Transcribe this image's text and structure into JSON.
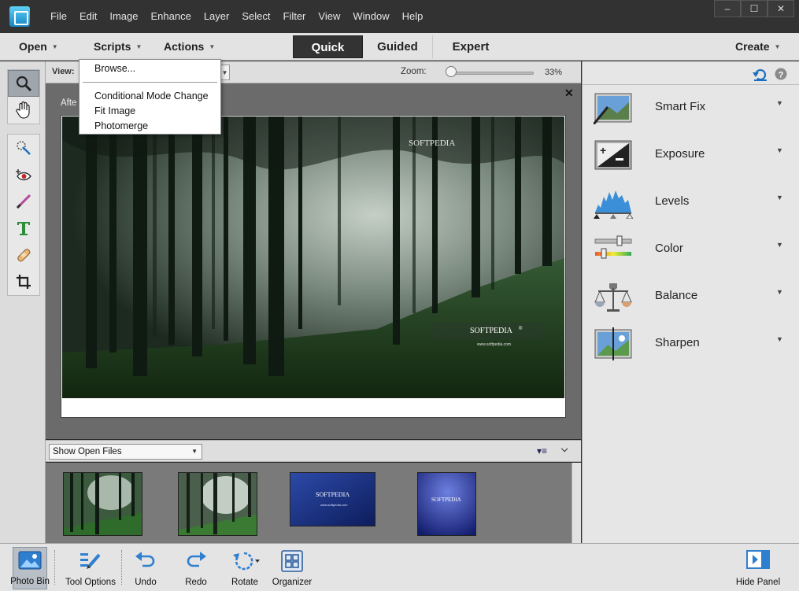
{
  "menubar": {
    "items": [
      "File",
      "Edit",
      "Image",
      "Enhance",
      "Layer",
      "Select",
      "Filter",
      "View",
      "Window",
      "Help"
    ],
    "window_buttons": [
      "–",
      "☐",
      "✕"
    ]
  },
  "modebar": {
    "open_label": "Open",
    "scripts_label": "Scripts",
    "actions_label": "Actions",
    "tabs": [
      "Quick",
      "Guided",
      "Expert"
    ],
    "active_tab": "Quick",
    "create_label": "Create"
  },
  "scripts_menu": {
    "items": [
      "Browse...",
      "Conditional Mode Change",
      "Fit Image",
      "Photomerge"
    ]
  },
  "tool_options": {
    "view_label": "View:",
    "zoom_label": "Zoom:",
    "zoom_value": "33%",
    "zoom_percent": 33
  },
  "document": {
    "tab_label": "Afte",
    "watermark_top": "SOFTPEDIA",
    "watermark_mid": "SOFTPEDIA",
    "watermark_mid_tm": "®",
    "watermark_url": "www.softpedia.com"
  },
  "photo_bin": {
    "dropdown_value": "Show Open Files",
    "thumb_watermark": "SOFTPEDIA",
    "thumb_url": "www.softpedia.com"
  },
  "quick_panel": {
    "fixes": [
      {
        "label": "Smart Fix",
        "icon": "smart-fix-icon"
      },
      {
        "label": "Exposure",
        "icon": "exposure-icon"
      },
      {
        "label": "Levels",
        "icon": "levels-icon"
      },
      {
        "label": "Color",
        "icon": "color-icon"
      },
      {
        "label": "Balance",
        "icon": "balance-icon"
      },
      {
        "label": "Sharpen",
        "icon": "sharpen-icon"
      }
    ]
  },
  "bottombar": {
    "buttons": [
      "Photo Bin",
      "Tool Options",
      "Undo",
      "Redo",
      "Rotate",
      "Organizer"
    ],
    "hide_panel": "Hide Panel"
  },
  "colors": {
    "menubar_bg": "#323232",
    "panel_bg": "#e3e3e3",
    "active_tab_bg": "#333333",
    "accent_blue": "#1a6fc0"
  }
}
